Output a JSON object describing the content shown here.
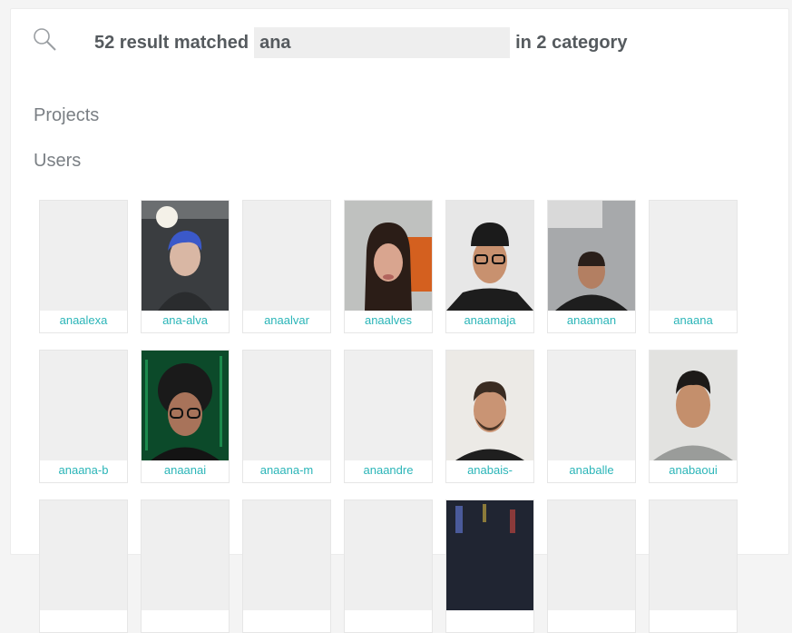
{
  "search": {
    "count_text": "52 result matched",
    "query": "ana",
    "category_text": "in 2 category"
  },
  "categories": {
    "projects": "Projects",
    "users": "Users"
  },
  "users": [
    {
      "login": "anaalexa",
      "photo": "none"
    },
    {
      "login": "ana-alva",
      "photo": "blue-hair"
    },
    {
      "login": "anaalvar",
      "photo": "none"
    },
    {
      "login": "anaalves",
      "photo": "long-dark-hair"
    },
    {
      "login": "anaamaja",
      "photo": "cap-glasses"
    },
    {
      "login": "anaaman",
      "photo": "dark-hoodie"
    },
    {
      "login": "anaana",
      "photo": "none"
    },
    {
      "login": "anaana-b",
      "photo": "none"
    },
    {
      "login": "anaanai",
      "photo": "curly-glasses"
    },
    {
      "login": "anaana-m",
      "photo": "none"
    },
    {
      "login": "anaandre",
      "photo": "none"
    },
    {
      "login": "anabais-",
      "photo": "beard-smile"
    },
    {
      "login": "anaballe",
      "photo": "none"
    },
    {
      "login": "anabaoui",
      "photo": "grey-polo"
    },
    {
      "login": "",
      "photo": "none"
    },
    {
      "login": "",
      "photo": "none"
    },
    {
      "login": "",
      "photo": "none"
    },
    {
      "login": "",
      "photo": "none"
    },
    {
      "login": "",
      "photo": "dark-scene"
    },
    {
      "login": "",
      "photo": "none"
    },
    {
      "login": "",
      "photo": "none"
    }
  ],
  "colors": {
    "accent": "#2bb5b8",
    "text": "#555a5e",
    "placeholder": "#efefef"
  }
}
